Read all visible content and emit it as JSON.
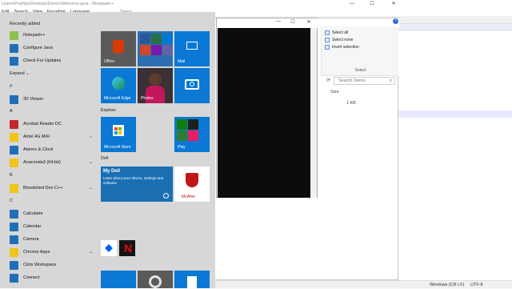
{
  "notepad": {
    "title": "Users\\Prathiju\\Desktop\\Demo\\Welcome.java - Notepad++",
    "menu": [
      "Edit",
      "Search",
      "View",
      "Encoding",
      "Language"
    ],
    "tab_label": "Demo",
    "status_eol": "Windows (CR LF)",
    "status_enc": "UTF-8"
  },
  "explorer": {
    "ribbon": [
      "Select all",
      "Select none",
      "Invert selection"
    ],
    "ribbon_group": "Select",
    "search_placeholder": "Search Demo",
    "col_size": "Size",
    "cell_size": "1 KB"
  },
  "start": {
    "recently_added": "Recently added",
    "expand": "Expand",
    "apps": [
      {
        "label": "Notepad++",
        "color": "#8bc34a"
      },
      {
        "label": "Configure Java",
        "color": "#1e6fb8"
      },
      {
        "label": "Check For Updates",
        "color": "#1e6fb8"
      },
      {
        "label": "3D Viewer",
        "color": "#1e6fb8"
      },
      {
        "label": "Acrobat Reader DC",
        "color": "#c1272d"
      },
      {
        "label": "Airtel 4G MiFi",
        "color": "#f0c419"
      },
      {
        "label": "Alarms & Clock",
        "color": "#1e6fb8"
      },
      {
        "label": "Anaconda3 (64-bit)",
        "color": "#f0c419"
      },
      {
        "label": "Bloodshed Dev-C++",
        "color": "#f0c419"
      },
      {
        "label": "Calculator",
        "color": "#1e6fb8"
      },
      {
        "label": "Calendar",
        "color": "#1e6fb8"
      },
      {
        "label": "Camera",
        "color": "#1e6fb8"
      },
      {
        "label": "Chrome Apps",
        "color": "#f0c419"
      },
      {
        "label": "Citrix Workspace",
        "color": "#1e6fb8"
      },
      {
        "label": "Connect",
        "color": "#1e6fb8"
      }
    ],
    "letters": [
      "#",
      "A",
      "B",
      "C"
    ],
    "groups": {
      "explore": "Explore",
      "dell": "Dell"
    },
    "tiles": {
      "office": "Office",
      "mail": "Mail",
      "edge": "Microsoft Edge",
      "photos": "Photos",
      "store": "Microsoft Store",
      "play": "Play",
      "mydell_title": "My Dell",
      "mydell_desc": "Learn about your device, settings and software",
      "mcafee": "McAfee"
    }
  }
}
